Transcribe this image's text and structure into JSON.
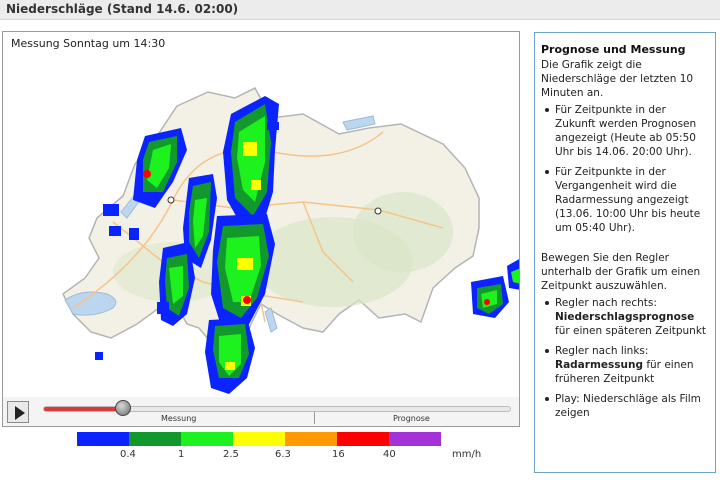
{
  "header": {
    "title": "Niederschläge (Stand 14.6. 02:00)"
  },
  "map": {
    "measurement_label": "Messung Sonntag um 14:30"
  },
  "controls": {
    "segment_left": "Messung",
    "segment_right": "Prognose",
    "slider_position_fraction": 0.17
  },
  "legend": {
    "colors": [
      "#0a23ff",
      "#119a2b",
      "#1ef21e",
      "#ffff00",
      "#ff9a00",
      "#ff0000",
      "#a333d6"
    ],
    "values": [
      "0.4",
      "1",
      "2.5",
      "6.3",
      "16",
      "40"
    ],
    "unit": "mm/h"
  },
  "panel": {
    "title": "Prognose und Messung",
    "intro": "Die Grafik zeigt die Niederschläge der letzten 10 Minuten an.",
    "bullets1": [
      "Für Zeitpunkte in der Zukunft werden Prognosen angezeigt (Heute ab 05:50 Uhr bis 14.06. 20:00 Uhr).",
      "Für Zeitpunkte in der Vergangenheit wird die Radarmessung angezeigt (13.06. 10:00 Uhr bis heute um 05:40 Uhr)."
    ],
    "slider_intro": "Bewegen Sie den Regler unterhalb der Grafik um einen Zeitpunkt auszuwählen.",
    "right_prefix": "Regler nach rechts:",
    "right_bold": "Niederschlagsprognose",
    "right_suffix": "für einen späteren Zeitpunkt",
    "left_prefix": "Regler nach links:",
    "left_bold": "Radarmessung",
    "left_suffix": "für einen früheren Zeitpunkt",
    "play_text": "Play: Niederschläge als Film zeigen"
  }
}
